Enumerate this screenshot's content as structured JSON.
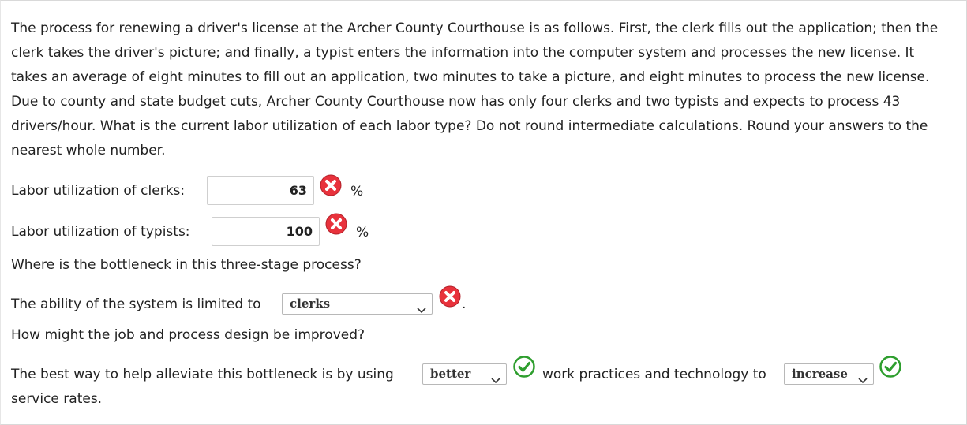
{
  "question": {
    "text": "The process for renewing a driver's license at the Archer County Courthouse is as follows. First, the clerk fills out the application; then the clerk takes the driver's picture; and finally, a typist enters the information into the computer system and processes the new license. It takes an average of eight minutes to fill out an application, two minutes to take a picture, and eight minutes to process the new license. Due to county and state budget cuts, Archer County Courthouse now has only four clerks and two typists and expects to process 43 drivers/hour. What is the current labor utilization of each labor type? Do not round intermediate calculations. Round your answers to the nearest whole number."
  },
  "clerks": {
    "label": "Labor utilization of clerks:",
    "value": "63",
    "unit": "%",
    "status": "incorrect"
  },
  "typists": {
    "label": "Labor utilization of typists:",
    "value": "100",
    "unit": "%",
    "status": "incorrect"
  },
  "bottleneck_question": "Where is the bottleneck in this three-stage process?",
  "bottleneck": {
    "prefix": "The ability of the system is limited to",
    "selected": "clerks",
    "suffix": ".",
    "status": "incorrect"
  },
  "improve_question": "How might the job and process design be improved?",
  "improve": {
    "prefix": "The best way to help alleviate this bottleneck is by using",
    "select1": "better",
    "middle": "work practices and technology to",
    "select2": "increase",
    "suffix": "service rates.",
    "status1": "correct",
    "status2": "correct"
  },
  "colors": {
    "incorrect": "#e8323c",
    "correct": "#2e9e2e",
    "text": "#222222",
    "border": "#cfcfcf"
  },
  "icons": {
    "incorrect": "x-circle-icon",
    "correct": "check-circle-icon",
    "dropdown": "chevron-down-icon"
  }
}
